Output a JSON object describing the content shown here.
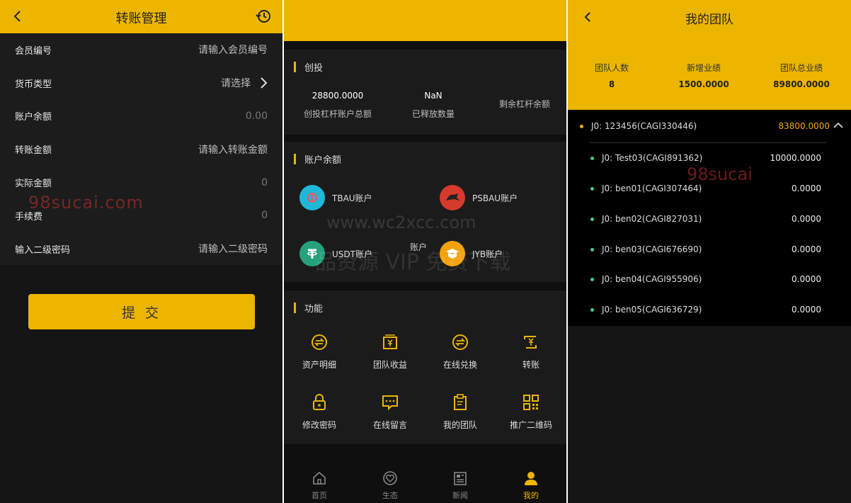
{
  "transfer": {
    "title": "转账管理",
    "rows": [
      {
        "label": "会员编号",
        "value": "请输入会员编号"
      },
      {
        "label": "货币类型",
        "value": "请选择"
      },
      {
        "label": "账户余额",
        "value": "0.00"
      },
      {
        "label": "转账金额",
        "value": "请输入转账金额"
      },
      {
        "label": "实际金额",
        "value": "0"
      },
      {
        "label": "手续费",
        "value": "0"
      },
      {
        "label": "输入二级密码",
        "value": "请输入二级密码"
      }
    ],
    "submit_label": "提 交",
    "watermark": "98sucai.com"
  },
  "home": {
    "section_invest": "创投",
    "stats": [
      {
        "value": "28800.0000",
        "label": "创投杠杆账户总额"
      },
      {
        "value": "NaN",
        "label": "已释放数量"
      },
      {
        "value": "",
        "label": "剩余杠杆余额"
      }
    ],
    "section_balance": "账户余额",
    "accounts": [
      {
        "label": "TBAU账户",
        "color": "#1fb8d8"
      },
      {
        "label": "PSBAU账户",
        "color": "#d63a2a"
      },
      {
        "label": "USDT账户",
        "color": "#26a17b"
      },
      {
        "label": "JYB账户",
        "color": "#f2a20c"
      }
    ],
    "watermark_a": "www.wc2xcc.com",
    "watermark_b": "账户",
    "watermark_c": "品资源 VIP 免费下载",
    "section_functions": "功能",
    "functions": [
      {
        "label": "资产明细",
        "icon": "exchange-icon"
      },
      {
        "label": "团队收益",
        "icon": "wallet-icon"
      },
      {
        "label": "在线兑换",
        "icon": "exchange-icon"
      },
      {
        "label": "转账",
        "icon": "transfer-icon"
      },
      {
        "label": "修改密码",
        "icon": "lock-icon"
      },
      {
        "label": "在线留言",
        "icon": "message-icon"
      },
      {
        "label": "我的团队",
        "icon": "clipboard-icon"
      },
      {
        "label": "推广二维码",
        "icon": "qrcode-icon"
      }
    ],
    "tabs": [
      {
        "label": "首页",
        "icon": "home-icon"
      },
      {
        "label": "生态",
        "icon": "heart-icon"
      },
      {
        "label": "新闻",
        "icon": "news-icon"
      },
      {
        "label": "我的",
        "icon": "user-icon"
      }
    ]
  },
  "team": {
    "title": "我的团队",
    "stats": [
      {
        "label": "团队人数",
        "value": "8"
      },
      {
        "label": "新增业绩",
        "value": "1500.0000"
      },
      {
        "label": "团队总业绩",
        "value": "89800.0000"
      }
    ],
    "root": {
      "label": "J0: 123456(CAGI330446)",
      "amount": "83800.0000"
    },
    "members": [
      {
        "label": "J0: Test03(CAGI891362)",
        "amount": "10000.0000"
      },
      {
        "label": "J0: ben01(CAGI307464)",
        "amount": "0.0000"
      },
      {
        "label": "J0: ben02(CAGI827031)",
        "amount": "0.0000"
      },
      {
        "label": "J0: ben03(CAGI676690)",
        "amount": "0.0000"
      },
      {
        "label": "J0: ben04(CAGI955906)",
        "amount": "0.0000"
      },
      {
        "label": "J0: ben05(CAGI636729)",
        "amount": "0.0000"
      }
    ],
    "watermark": "98sucai"
  },
  "colors": {
    "accent": "#ecb500",
    "member_dot": "#3ecf8e",
    "root_amount": "#f0a81c"
  }
}
